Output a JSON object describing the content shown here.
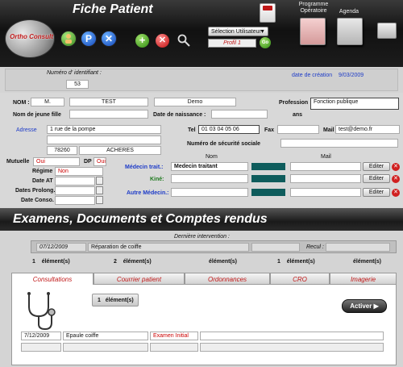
{
  "header": {
    "title": "Fiche Patient",
    "logo_text": "Ortho Consult",
    "user_select": "Sélection Utilisateur",
    "profile": "Profil 1",
    "go": "Go",
    "programme_label": "Programme Opératoire",
    "agenda_label": "Agenda"
  },
  "identification": {
    "id_label": "Numéro d' identifiant :",
    "id_value": "53",
    "creation_label": "date de création",
    "creation_value": "9/03/2009"
  },
  "patient": {
    "nom_label": "NOM :",
    "civilite": "M.",
    "nom": "TEST",
    "prenom": "Demo",
    "profession_label": "Profession",
    "profession": "Fonction publique",
    "jeune_fille_label": "Nom de jeune fille",
    "naissance_label": "Date de naissance :",
    "ans_label": "ans",
    "adresse_label": "Adresse",
    "adresse": "1 rue de la pompe",
    "cp": "78260",
    "ville": "ACHERES",
    "tel_label": "Tel",
    "tel": "01 03 04 05 06",
    "fax_label": "Fax",
    "mail_label": "Mail",
    "mail": "test@demo.fr",
    "secu_label": "Numéro de sécurité sociale",
    "mutuelle_label": "Mutuelle",
    "mutuelle": "Oui",
    "dp_label": "DP",
    "dp": "Oui",
    "regime_label": "Régime",
    "regime": "Non",
    "date_at_label": "Date AT",
    "prolong_label": "Dates Prolong.",
    "conso_label": "Date Conso."
  },
  "medecins": {
    "col_nom": "Nom",
    "col_mail": "Mail",
    "traitant_label": "Médecin trait.:",
    "traitant": "Medecin traitant",
    "kine_label": "Kiné:",
    "autre_label": "Autre Médecin.:",
    "edit_label": "Editer"
  },
  "exams": {
    "section_title": "Examens, Documents et Comptes rendus",
    "derniere_label": "Dernière intervention :",
    "derniere_date": "07/12/2009",
    "derniere_texte": "Réparation de coiffe",
    "recul_label": "Recul :",
    "counts": [
      "1",
      "2",
      "",
      "1",
      ""
    ],
    "count_suffix": "élément(s)",
    "tabs": [
      "Consultations",
      "Courrier patient",
      "Ordonnances",
      "CRO",
      "Imagerie"
    ],
    "list_count": "1",
    "activer": "Activer",
    "row": {
      "date": "7/12/2009",
      "motif": "Epaule coiffe",
      "type": "Examen Initial"
    }
  },
  "colors": {
    "accent_red": "#c01818",
    "link_blue": "#1e3cc8",
    "teal": "#0e5c5c"
  }
}
